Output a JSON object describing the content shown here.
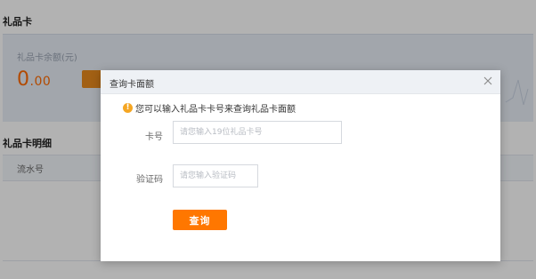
{
  "page": {
    "section_title": "礼品卡",
    "balance_label": "礼品卡余额(元)",
    "balance_int": "0",
    "balance_dec": ".00",
    "detail_title": "礼品卡明细",
    "detail_columns": [
      "流水号"
    ]
  },
  "modal": {
    "title": "查询卡面额",
    "tip": "您可以输入礼品卡卡号来查询礼品卡面额",
    "card_label": "卡号",
    "card_placeholder": "请您输入19位礼品卡号",
    "code_label": "验证码",
    "code_placeholder": "请您输入验证码",
    "query_button": "查询"
  },
  "colors": {
    "accent": "#ff7700",
    "balance": "#ff6a00",
    "tip_icon": "#f5a623"
  },
  "icons": {
    "close": "close-icon",
    "tip": "warning-icon"
  }
}
